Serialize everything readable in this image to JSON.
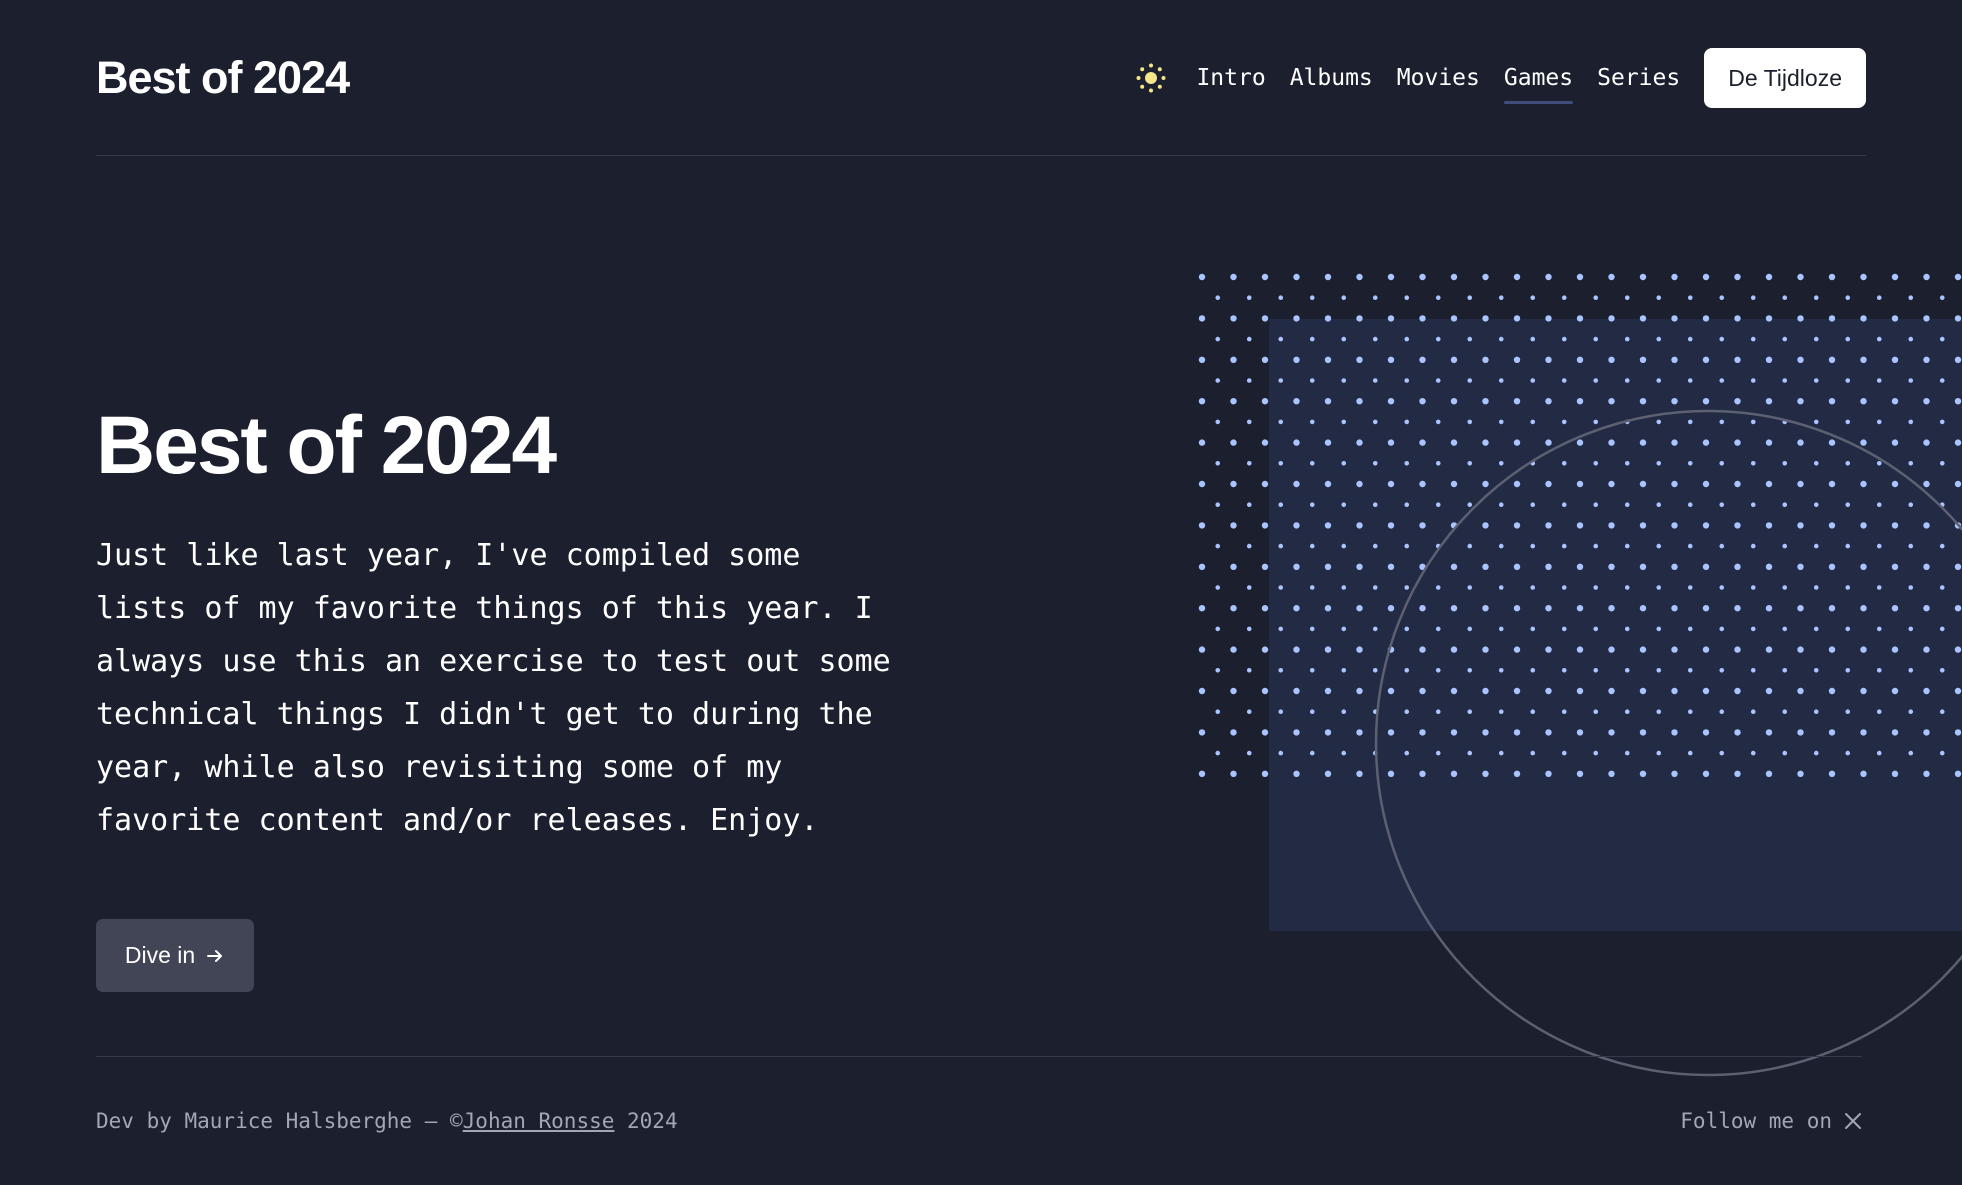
{
  "header": {
    "brand": "Best of 2024",
    "theme_icon": "sun-icon",
    "nav": [
      {
        "label": "Intro",
        "active": false
      },
      {
        "label": "Albums",
        "active": false
      },
      {
        "label": "Movies",
        "active": false
      },
      {
        "label": "Games",
        "active": true
      },
      {
        "label": "Series",
        "active": false
      }
    ],
    "cta_label": "De Tijdloze"
  },
  "hero": {
    "title": "Best of 2024",
    "body_lines": [
      "Just like last year, I've compiled some",
      "lists of my favorite things of this year. I",
      "always use this an exercise to test out some",
      "technical things I didn't get to during the",
      "year, while also revisiting some of my",
      "favorite content and/or releases. Enjoy."
    ],
    "button_label": "Dive in",
    "button_icon": "arrow-right-icon"
  },
  "footer": {
    "prefix": "Dev by Maurice Halsberghe — ©",
    "link": "Johan Ronsse",
    "suffix": " 2024",
    "follow_label": "Follow me on",
    "follow_icon": "x-logo-icon"
  },
  "colors": {
    "background": "#1b1f2e",
    "panel": "#232a44",
    "dots": "#a9c4ff",
    "sun": "#f5e58a",
    "button": "#414555"
  }
}
